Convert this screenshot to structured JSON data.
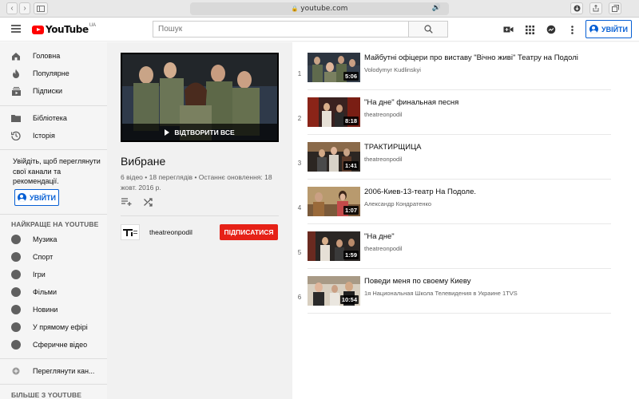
{
  "browser": {
    "url": "youtube.com"
  },
  "header": {
    "logo_text": "YouTube",
    "region": "UA",
    "search_placeholder": "Пошук",
    "signin_label": "УВІЙТИ"
  },
  "sidebar": {
    "main_items": [
      {
        "label": "Головна",
        "icon": "home-icon"
      },
      {
        "label": "Популярне",
        "icon": "trending-icon"
      },
      {
        "label": "Підписки",
        "icon": "subscriptions-icon"
      }
    ],
    "library_items": [
      {
        "label": "Бібліотека",
        "icon": "library-icon"
      },
      {
        "label": "Історія",
        "icon": "history-icon"
      }
    ],
    "signin_prompt": "Увійдіть, щоб переглянути свої канали та рекомендації.",
    "signin_label": "УВІЙТИ",
    "best_heading": "НАЙКРАЩЕ НА YOUTUBE",
    "best_items": [
      {
        "label": "Музика",
        "icon": "music-icon"
      },
      {
        "label": "Спорт",
        "icon": "sports-icon"
      },
      {
        "label": "Ігри",
        "icon": "gaming-icon"
      },
      {
        "label": "Фільми",
        "icon": "movies-icon"
      },
      {
        "label": "Новини",
        "icon": "news-icon"
      },
      {
        "label": "У прямому ефірі",
        "icon": "live-icon"
      },
      {
        "label": "Сферичне відео",
        "icon": "360-video-icon"
      }
    ],
    "browse_channels": "Переглянути кан...",
    "more_heading": "БІЛЬШЕ З YOUTUBE"
  },
  "playlist": {
    "play_all": "ВІДТВОРИТИ ВСЕ",
    "title": "Вибране",
    "video_count": "6 відео",
    "views": "18 переглядів",
    "updated": "Останнє оновлення: 18 жовт. 2016 р.",
    "owner": "theatreonpodil",
    "subscribe_label": "ПІДПИСАТИСЯ"
  },
  "videos": [
    {
      "index": "1",
      "title": "Майбутні офіцери про виставу \"Вічно живі\" Театру на Подолі",
      "channel": "Volodymyr Kudlinskyi",
      "duration": "5:06"
    },
    {
      "index": "2",
      "title": "\"На дне\" финальная песня",
      "channel": "theatreonpodil",
      "duration": "8:18"
    },
    {
      "index": "3",
      "title": "ТРАКТИРЩИЦА",
      "channel": "theatreonpodil",
      "duration": "1:41"
    },
    {
      "index": "4",
      "title": "2006-Киев-13-театр На Подоле.",
      "channel": "Александр Кондратенко",
      "duration": "1:07"
    },
    {
      "index": "5",
      "title": "\"На дне\"",
      "channel": "theatreonpodil",
      "duration": "1:59"
    },
    {
      "index": "6",
      "title": "Поведи меня по своему Киеву",
      "channel": "1я Национальная Школа Телевидения в Украине 1TVS",
      "duration": "10:54"
    }
  ]
}
